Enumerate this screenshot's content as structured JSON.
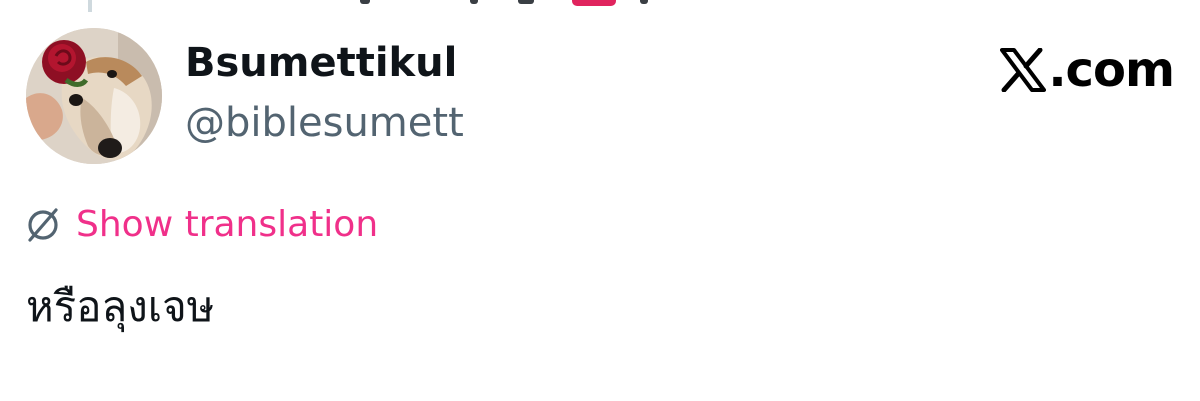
{
  "post": {
    "author": {
      "display_name": "Bsumettikul",
      "handle": "@biblesumett",
      "avatar_icon": "dog-with-rose-avatar"
    },
    "brand": {
      "icon": "x-logo-icon",
      "label": ".com"
    },
    "translation": {
      "icon": "translate-icon",
      "label": "Show translation"
    },
    "text": "หรือลุงเจษ"
  },
  "colors": {
    "accent": "#f0308a",
    "name": "#0f1419",
    "handle": "#536471",
    "thread_line": "#cfd9de"
  }
}
